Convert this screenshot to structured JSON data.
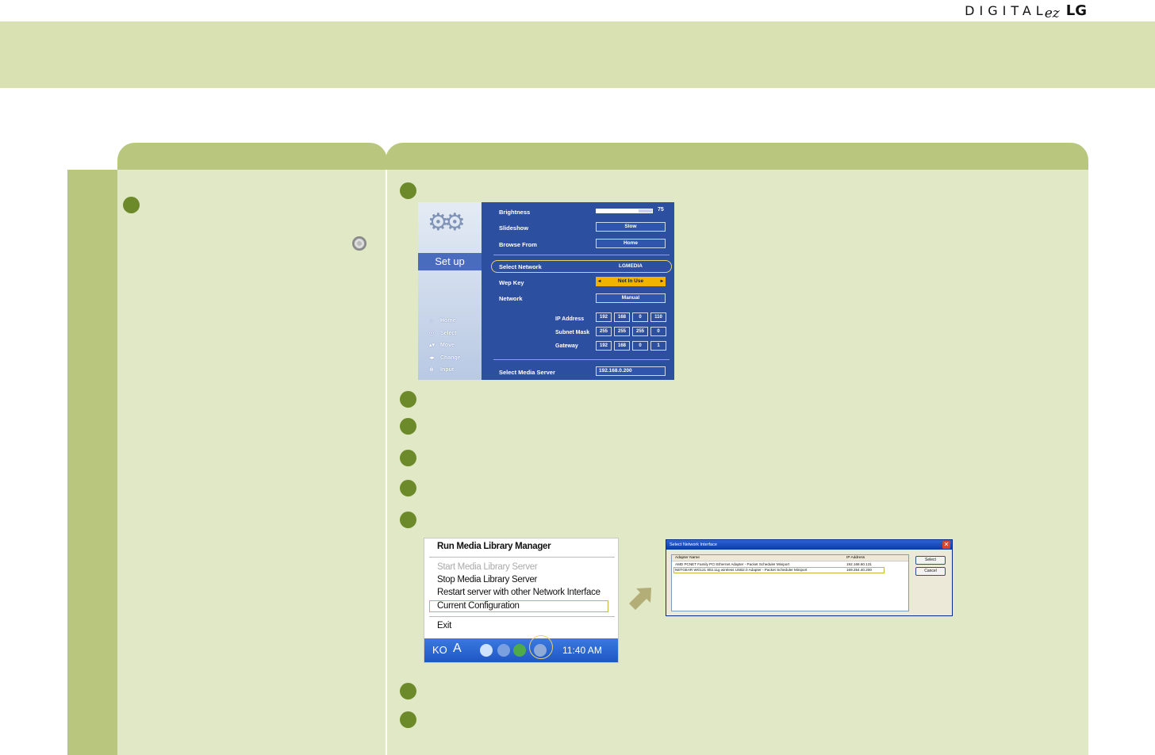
{
  "brand": {
    "digital": "DIGITAL",
    "ez": "ez",
    "lg": "LG"
  },
  "setup": {
    "side_title": "Set up",
    "hints": [
      {
        "icon": "home-icon",
        "symbol": "⌂",
        "label": "Home"
      },
      {
        "icon": "select-icon",
        "symbol": "◎",
        "label": "Select"
      },
      {
        "icon": "move-icon",
        "symbol": "▴▾",
        "label": "Move"
      },
      {
        "icon": "change-icon",
        "symbol": "◂▸",
        "label": "Change"
      },
      {
        "icon": "input-icon",
        "symbol": "⊕",
        "label": "Input"
      }
    ],
    "brightness_label": "Brightness",
    "brightness_value": "75",
    "brightness_level": 0.75,
    "slideshow_label": "Slideshow",
    "slideshow_value": "Slow",
    "browse_label": "Browse From",
    "browse_value": "Home",
    "select_network_label": "Select Network",
    "select_network_value": "LGMEDIA",
    "wep_label": "Wep Key",
    "wep_value": "Not In Use",
    "network_label": "Network",
    "network_value": "Manual",
    "ip_label": "IP Address",
    "ip": [
      "192",
      "168",
      "0",
      "110"
    ],
    "subnet_label": "Subnet Mask",
    "subnet": [
      "255",
      "255",
      "255",
      "0"
    ],
    "gateway_label": "Gateway",
    "gateway": [
      "192",
      "168",
      "0",
      "1"
    ],
    "media_server_label": "Select Media Server",
    "media_server_value": "192.168.0.200"
  },
  "tray": {
    "items": [
      {
        "label": "Run Media Library Manager",
        "style": "bold"
      },
      {
        "label": "Start Media Library Server",
        "style": "dim"
      },
      {
        "label": "Stop Media Library Server",
        "style": "normal"
      },
      {
        "label": "Restart server with other Network Interface",
        "style": "normal"
      },
      {
        "label": "Current Configuration",
        "style": "normal"
      },
      {
        "label": "Exit",
        "style": "normal"
      }
    ],
    "taskbar_lang": "KO",
    "taskbar_a": "A",
    "taskbar_time": "11:40 AM"
  },
  "dialog": {
    "title": "Select Network Interface",
    "col_adapter": "Adapter Name",
    "col_ip": "IP Address",
    "rows": [
      {
        "adapter": "AMD PCNET Family PCI Ethernet Adapter - Packet Scheduler Miniport",
        "ip": "192.168.60.131"
      },
      {
        "adapter": "NETGEAR WG121 802.11g wireless USB2.0 Adapter - Packet Scheduler Miniport",
        "ip": "169.254.40.200"
      }
    ],
    "select_btn": "Select",
    "cancel_btn": "Cancel"
  }
}
